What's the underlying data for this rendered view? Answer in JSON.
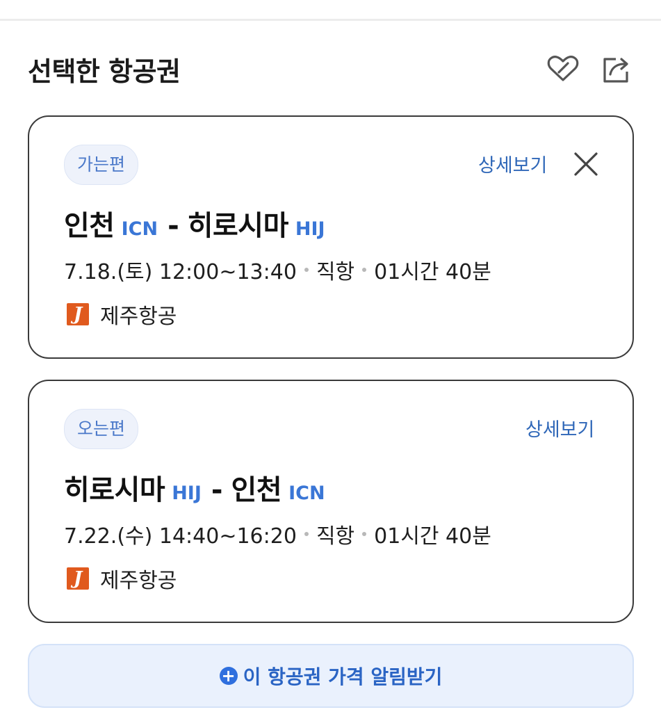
{
  "header": {
    "title": "선택한 항공권",
    "icons": {
      "favorite": "heart-link-icon",
      "share": "share-icon"
    }
  },
  "outbound": {
    "chip": "가는편",
    "detail_label": "상세보기",
    "from_city": "인천",
    "from_code": "ICN",
    "dash": "-",
    "to_city": "히로시마",
    "to_code": "HIJ",
    "date_time": "7.18.(토) 12:00~13:40",
    "flight_type": "직항",
    "duration": "01시간 40분",
    "airline_logo": "J",
    "airline": "제주항공"
  },
  "inbound": {
    "chip": "오는편",
    "detail_label": "상세보기",
    "from_city": "히로시마",
    "from_code": "HIJ",
    "dash": "-",
    "to_city": "인천",
    "to_code": "ICN",
    "date_time": "7.22.(수) 14:40~16:20",
    "flight_type": "직항",
    "duration": "01시간 40분",
    "airline_logo": "J",
    "airline": "제주항공"
  },
  "alert": {
    "icon": "+",
    "label": "이 항공권 가격 알림받기"
  },
  "colors": {
    "accent": "#3a76d6",
    "link": "#2f67b8",
    "airline_brand": "#e05a1e",
    "alert_bg": "#eaf1fd"
  }
}
